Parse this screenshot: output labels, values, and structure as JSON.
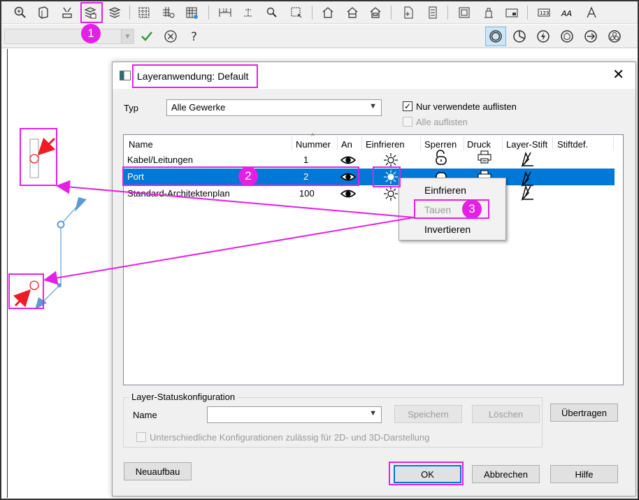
{
  "dialog": {
    "title": "Layeranwendung: Default",
    "typ_label": "Typ",
    "typ_value": "Alle Gewerke",
    "only_used_label": "Nur verwendete auflisten",
    "show_all_label": "Alle auflisten",
    "columns": [
      "Name",
      "Nummer",
      "An",
      "Einfrieren",
      "Sperren",
      "Druck",
      "Layer-Stift",
      "Stiftdef."
    ],
    "rows": [
      {
        "name": "Kabel/Leitungen",
        "number": "1"
      },
      {
        "name": "Port",
        "number": "2"
      },
      {
        "name": "Standard-Architektenplan",
        "number": "100"
      }
    ],
    "status_group": {
      "legend": "Layer-Statuskonfiguration",
      "name_label": "Name",
      "name_value": "",
      "save_label": "Speichern",
      "delete_label": "Löschen",
      "different_config_label": "Unterschiedliche Konfigurationen zulässig für 2D- und 3D-Darstellung"
    },
    "transfer_label": "Übertragen",
    "rebuild_label": "Neuaufbau",
    "ok_label": "OK",
    "cancel_label": "Abbrechen",
    "help_label": "Hilfe"
  },
  "context_menu": {
    "items": [
      "Einfrieren",
      "Tauen",
      "Invertieren"
    ]
  },
  "badges": [
    "1",
    "2",
    "3"
  ],
  "colors": {
    "highlight": "#e520e5",
    "selection": "#0078d7",
    "arrow_red": "#ee1c24",
    "blue_shape": "#5b9bd5"
  }
}
